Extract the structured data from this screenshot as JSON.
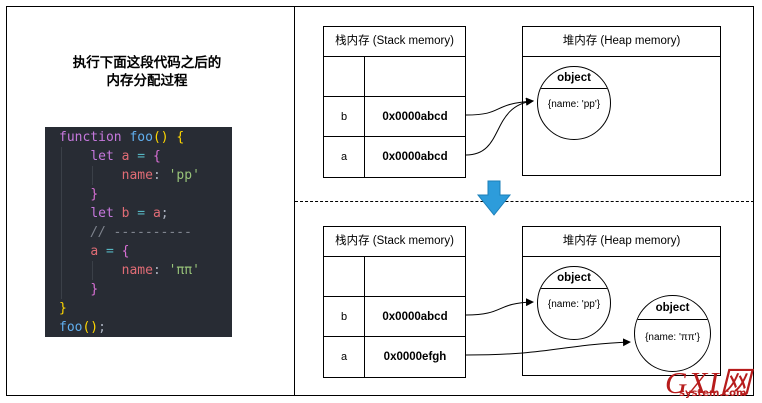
{
  "title": {
    "line1": "执行下面这段代码之后的",
    "line2": "内存分配过程"
  },
  "code": {
    "function_kw": "function",
    "fn_name": "foo",
    "let_kw": "let",
    "var_a": "a",
    "var_b": "b",
    "prop_name": "name",
    "str_pp": "'pp'",
    "str_pipi": "'ππ'",
    "comment": "// ----------",
    "call": "foo"
  },
  "top": {
    "stack": {
      "header": "栈内存 (Stack memory)",
      "rows": [
        {
          "key": "",
          "value": ""
        },
        {
          "key": "b",
          "value": "0x0000abcd"
        },
        {
          "key": "a",
          "value": "0x0000abcd"
        }
      ]
    },
    "heap": {
      "header": "堆内存 (Heap memory)",
      "object": {
        "title": "object",
        "body": "{name: 'pp'}"
      }
    }
  },
  "bottom": {
    "stack": {
      "header": "栈内存 (Stack memory)",
      "rows": [
        {
          "key": "",
          "value": ""
        },
        {
          "key": "b",
          "value": "0x0000abcd"
        },
        {
          "key": "a",
          "value": "0x0000efgh"
        }
      ]
    },
    "heap": {
      "header": "堆内存 (Heap memory)",
      "object1": {
        "title": "object",
        "body": "{name: 'pp'}"
      },
      "object2": {
        "title": "object",
        "body": "{name: 'ππ'}"
      }
    }
  },
  "watermark": {
    "big": "GXI网",
    "small": "system.com"
  },
  "colors": {
    "arrow_down": "#2d9cdb",
    "code_bg": "#282c34",
    "watermark": "#b71c1c"
  }
}
